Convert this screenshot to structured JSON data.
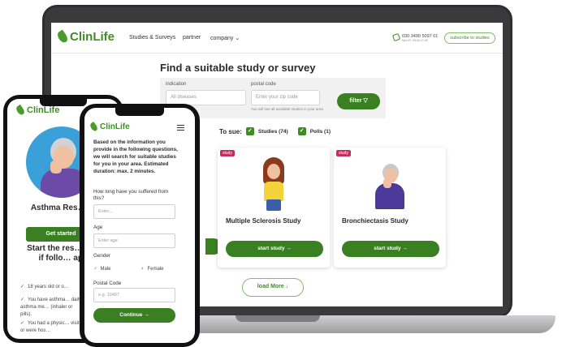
{
  "site": {
    "brand": "ClinLife",
    "nav": [
      "Studies & Surveys",
      "partner",
      "company"
    ],
    "phone": "030 3490 5097 01",
    "phone_hours": "Mon-Fr. 09:00-17:00",
    "subscribe_label": "subscribe to studies"
  },
  "search": {
    "title": "Find a suitable study or survey",
    "indication_label": "indication",
    "indication_placeholder": "All diseases",
    "postal_label": "postal code",
    "postal_placeholder": "Enter your zip code",
    "postal_note": "You will see all available studies in your area",
    "filter_label": "filter ▽",
    "to_sue_label": "To sue:",
    "studies_check": "Studies (74)",
    "polls_check": "Polls (1)"
  },
  "cards": [
    {
      "tag": "study",
      "title": "Multiple Sclerosis Study",
      "button": "start study →"
    },
    {
      "tag": "study",
      "title": "Bronchiectasis Study",
      "button": "start study →"
    }
  ],
  "load_more_label": "load More ↓",
  "phone_left": {
    "brand": "ClinLife",
    "title": "Asthma Res… Study",
    "get_started": "Get started",
    "start_text": "Start the res… study if follo… apply",
    "bullets": [
      "18 years old or o…",
      "You have asthma… daily asthma me… (inhaler or pills).",
      "You had a physic… visit or were hos…"
    ]
  },
  "phone_right": {
    "brand": "ClinLife",
    "intro": "Based on the information you provide in the following questions, we will search for suitable studies for you in your area. Estimated duration: max. 2 minutes.",
    "q1_label": "How long have you suffered from this?",
    "q1_placeholder": "Enter...",
    "age_label": "Age",
    "age_placeholder": "Enter age",
    "gender_label": "Gender",
    "male": "Male",
    "female": "Female",
    "postal_label": "Postal Code",
    "postal_placeholder": "e.g. 10407",
    "continue_label": "Continue →"
  },
  "colors": {
    "brand_green": "#3a7f22",
    "tag_pink": "#c22f5f",
    "hero_blue": "#3aa0d9"
  }
}
